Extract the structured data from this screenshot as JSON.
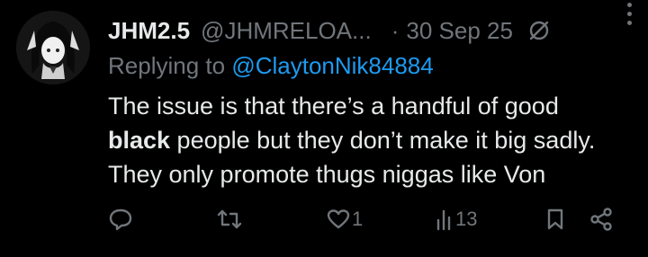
{
  "post": {
    "display_name": "JHM2.5",
    "handle": "@JHMRELOA...",
    "separator": "·",
    "date": "30 Sep 25",
    "replying_prefix": "Replying to",
    "replying_to": "@ClaytonNik84884",
    "body_line1": "The issue is that there’s a handful of good",
    "body_bold": "black",
    "body_line2_rest": " people but they don’t make it big sadly.",
    "body_line3": "They only promote thugs niggas like Von"
  },
  "actions": {
    "reply_count": "",
    "repost_count": "",
    "like_count": "1",
    "views_count": "13"
  },
  "icons": {
    "mute": "muted-conversation-icon",
    "more": "more-options-icon",
    "reply": "reply-icon",
    "repost": "repost-icon",
    "like": "heart-icon",
    "views": "views-chart-icon",
    "bookmark": "bookmark-icon",
    "share": "share-icon"
  },
  "colors": {
    "background": "#000000",
    "primary_text": "#e7e9ea",
    "secondary_text": "#71767b",
    "link": "#1d9bf0"
  }
}
